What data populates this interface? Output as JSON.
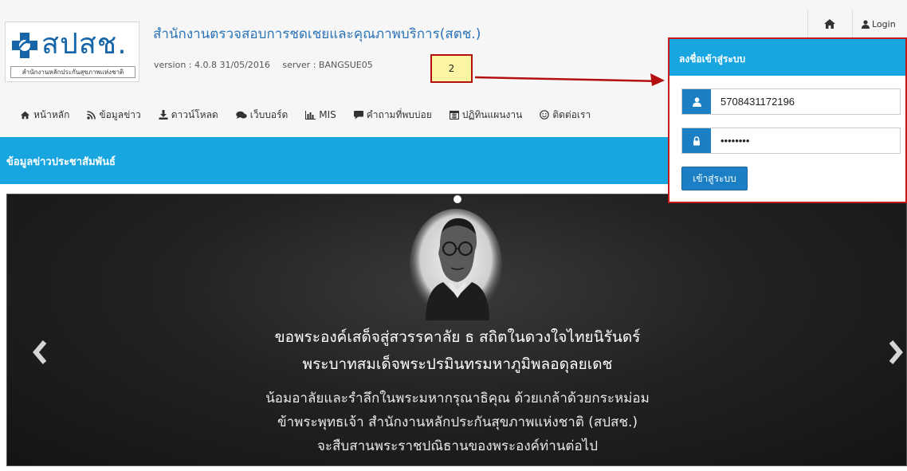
{
  "header": {
    "logo_text": "สปสช.",
    "logo_subtitle": "สำนักงานหลักประกันสุขภาพแห่งชาติ",
    "org_title": "สำนักงานตรวจสอบการชดเชยและคุณภาพบริการ(สตช.)",
    "version": "version : 4.0.8 31/05/2016",
    "server": "server : BANGSUE05"
  },
  "annotation": {
    "step_label": "2"
  },
  "utility": {
    "login_label": "Login"
  },
  "nav": {
    "items": [
      {
        "label": "หน้าหลัก",
        "icon": "home-icon"
      },
      {
        "label": "ข้อมูลข่าว",
        "icon": "rss-icon"
      },
      {
        "label": "ดาวน์โหลด",
        "icon": "download-icon"
      },
      {
        "label": "เว็บบอร์ด",
        "icon": "comments-icon"
      },
      {
        "label": "MIS",
        "icon": "bar-chart-icon"
      },
      {
        "label": "คำถามที่พบบ่อย",
        "icon": "comment-icon"
      },
      {
        "label": "ปฏิทินแผนงาน",
        "icon": "calendar-icon"
      },
      {
        "label": "ติดต่อเรา",
        "icon": "smile-icon"
      }
    ]
  },
  "banner": {
    "title": "ข้อมูลข่าวประชาสัมพันธ์"
  },
  "carousel": {
    "line1": "ขอพระองค์เสด็จสู่สวรรคาลัย ธ สถิตในดวงใจไทยนิรันดร์",
    "line2": "พระบาทสมเด็จพระปรมินทรมหาภูมิพลอดุลยเดช",
    "line3": "น้อมอาลัยและรำลึกในพระมหากรุณาธิคุณ ด้วยเกล้าด้วยกระหม่อม",
    "line4": "ข้าพระพุทธเจ้า สำนักงานหลักประกันสุขภาพแห่งชาติ (สปสช.)",
    "line5": "จะสืบสานพระราชปณิธานของพระองค์ท่านต่อไป"
  },
  "login": {
    "title": "ลงชื่อเข้าสู่ระบบ",
    "username": "5708431172196",
    "password": "••••••••",
    "submit_label": "เข้าสู่ระบบ"
  },
  "colors": {
    "accent": "#18a6e0",
    "button": "#1a7fc4",
    "annotation_border": "#c41a1a",
    "annotation_fill": "#fbf5a4"
  }
}
